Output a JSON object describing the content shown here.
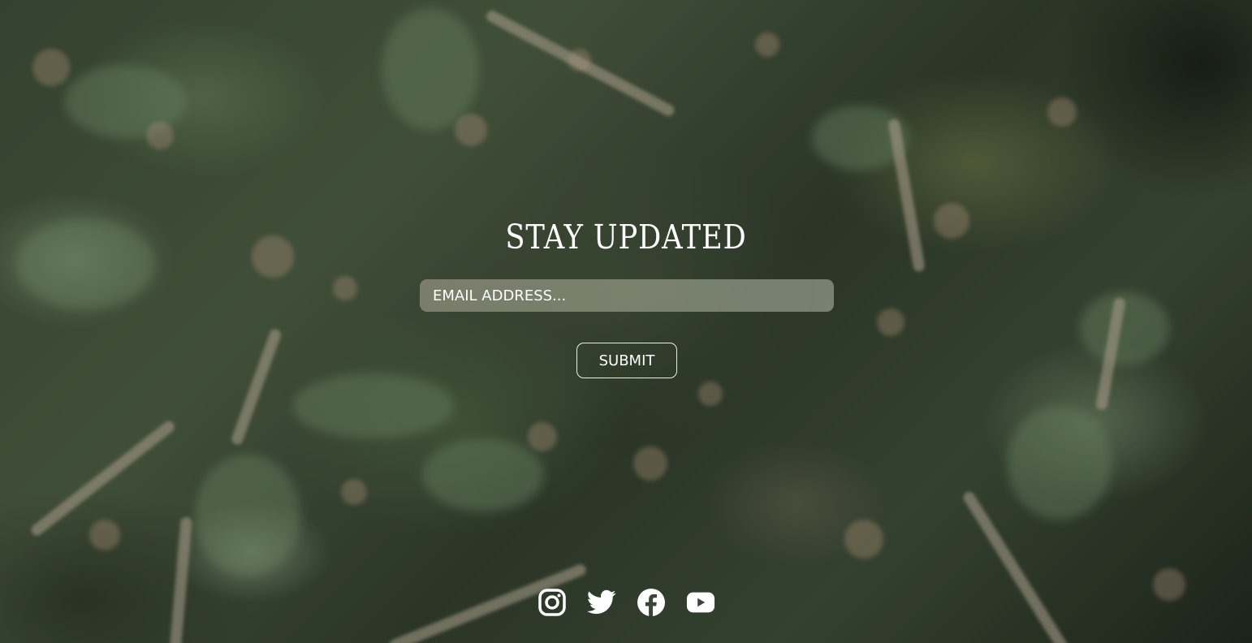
{
  "newsletter": {
    "heading": "STAY UPDATED",
    "email_placeholder": "EMAIL ADDRESS...",
    "email_value": "",
    "submit_label": "SUBMIT"
  },
  "social_links": [
    {
      "icon": "instagram-icon",
      "label": "Instagram"
    },
    {
      "icon": "twitter-icon",
      "label": "Twitter"
    },
    {
      "icon": "facebook-icon",
      "label": "Facebook"
    },
    {
      "icon": "youtube-icon",
      "label": "YouTube"
    }
  ],
  "colors": {
    "text": "#ffffff",
    "background": "#2f3b2b",
    "field_background": "#a9ab97"
  }
}
